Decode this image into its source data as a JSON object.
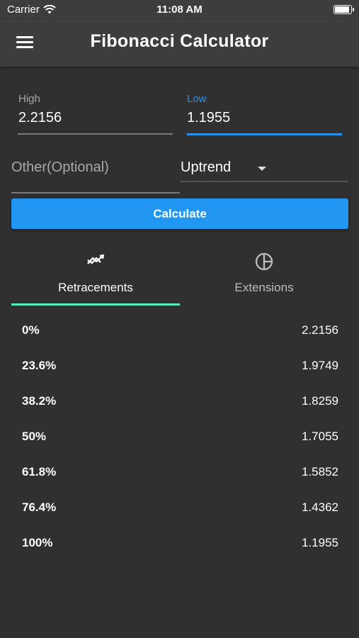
{
  "status_bar": {
    "carrier": "Carrier",
    "time": "11:08 AM",
    "battery_level": 1.0
  },
  "app_bar": {
    "title": "Fibonacci Calculator",
    "menu_icon": "menu-icon"
  },
  "form": {
    "high": {
      "label": "High",
      "value": "2.2156"
    },
    "low": {
      "label": "Low",
      "value": "1.1955",
      "focused": true
    },
    "other": {
      "placeholder": "Other(Optional)",
      "value": ""
    },
    "trend": {
      "selected": "Uptrend"
    },
    "calculate_label": "Calculate"
  },
  "tabs": [
    {
      "label": "Retracements",
      "icon": "trend-lines-icon",
      "selected": true
    },
    {
      "label": "Extensions",
      "icon": "pie-circle-icon",
      "selected": false
    }
  ],
  "retracements": [
    {
      "level": "0%",
      "value": "2.2156"
    },
    {
      "level": "23.6%",
      "value": "1.9749"
    },
    {
      "level": "38.2%",
      "value": "1.8259"
    },
    {
      "level": "50%",
      "value": "1.7055"
    },
    {
      "level": "61.8%",
      "value": "1.5852"
    },
    {
      "level": "76.4%",
      "value": "1.4362"
    },
    {
      "level": "100%",
      "value": "1.1955"
    }
  ],
  "colors": {
    "background": "#303030",
    "app_bar": "#3d3d3d",
    "accent": "#2196f3",
    "tab_indicator": "#63e6be"
  }
}
